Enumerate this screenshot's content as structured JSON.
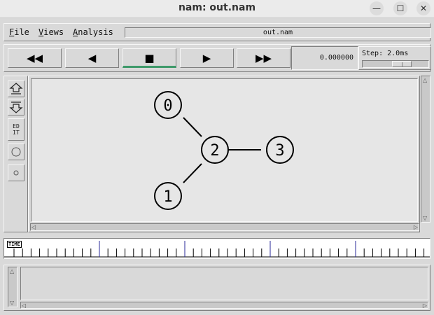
{
  "window": {
    "title": "nam: out.nam",
    "minimize_glyph": "—",
    "maximize_glyph": "☐",
    "close_glyph": "✕"
  },
  "menubar": {
    "file": {
      "accel": "F",
      "rest": "ile"
    },
    "views": {
      "accel": "V",
      "rest": "iews"
    },
    "analysis": {
      "accel": "A",
      "rest": "nalysis"
    },
    "filename": "out.nam"
  },
  "controls": {
    "buttons": [
      {
        "name": "fast-rewind-button",
        "glyph": "◀◀",
        "active": false
      },
      {
        "name": "play-backward-button",
        "glyph": "◀",
        "active": false
      },
      {
        "name": "stop-button",
        "glyph": "■",
        "active": true
      },
      {
        "name": "play-forward-button",
        "glyph": "▶",
        "active": false
      },
      {
        "name": "fast-forward-button",
        "glyph": "▶▶",
        "active": false
      }
    ],
    "time": "0.000000",
    "step_label": "Step: 2.0ms"
  },
  "toolbar": {
    "zoom_in_icon": "zoom-in-icon",
    "zoom_out_icon": "zoom-out-icon",
    "edit_label_top": "ED",
    "edit_label_bottom": "IT"
  },
  "topology": {
    "nodes": [
      {
        "id": "0",
        "label": "0"
      },
      {
        "id": "1",
        "label": "1"
      },
      {
        "id": "2",
        "label": "2"
      },
      {
        "id": "3",
        "label": "3"
      }
    ],
    "links": [
      [
        "0",
        "2"
      ],
      [
        "1",
        "2"
      ],
      [
        "2",
        "3"
      ]
    ]
  },
  "timeline": {
    "label": "TIME"
  }
}
